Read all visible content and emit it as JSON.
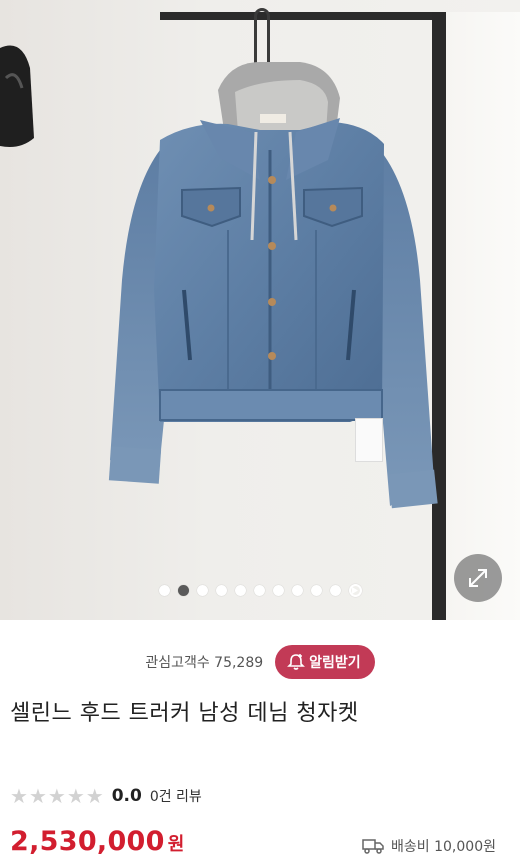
{
  "product_image": {
    "slide_count": 11,
    "active_index": 1
  },
  "interest": {
    "label": "관심고객수 75,289"
  },
  "alert_button": {
    "label": "알림받기"
  },
  "product": {
    "title": "셀린느 후드 트러커 남성 데님 청자켓",
    "rating_value": 0.0,
    "rating_label": "0.0",
    "review_label": "0건 리뷰",
    "price": "2,530,000",
    "currency": "원",
    "shipping_label": "배송비 10,000원"
  },
  "colors": {
    "accent": "#c23a56",
    "price": "#d21e2f",
    "star_empty": "#d2d2d2"
  },
  "icons": [
    "bell-plus-icon",
    "expand-icon",
    "play-icon",
    "truck-icon",
    "star-icon"
  ]
}
